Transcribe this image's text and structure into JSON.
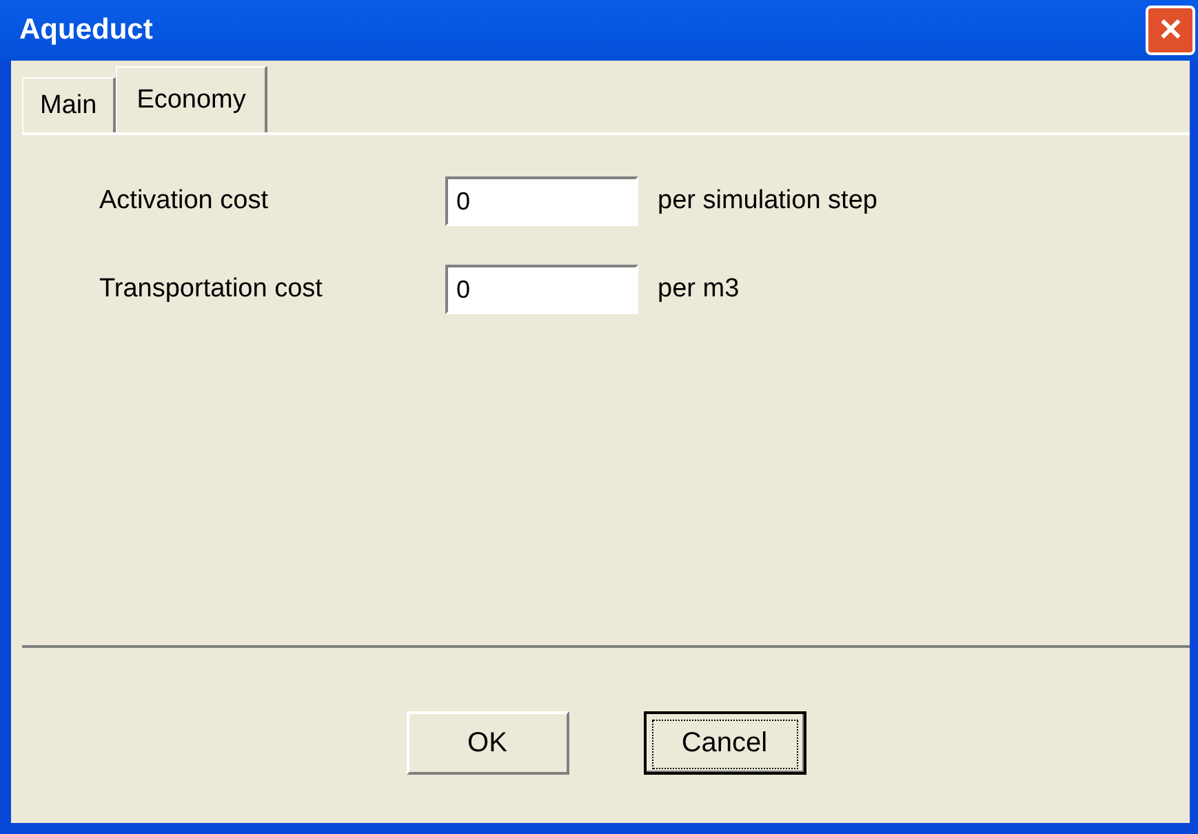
{
  "window": {
    "title": "Aqueduct",
    "close": "✕"
  },
  "tabs": [
    {
      "label": "Main",
      "selected": false
    },
    {
      "label": "Economy",
      "selected": true
    }
  ],
  "fields": [
    {
      "label": "Activation cost",
      "value": "0",
      "unit": "per simulation step"
    },
    {
      "label": "Transportation cost",
      "value": "0",
      "unit": "per m3"
    }
  ],
  "buttons": [
    {
      "label": "OK",
      "focused": false
    },
    {
      "label": "Cancel",
      "focused": true
    }
  ]
}
